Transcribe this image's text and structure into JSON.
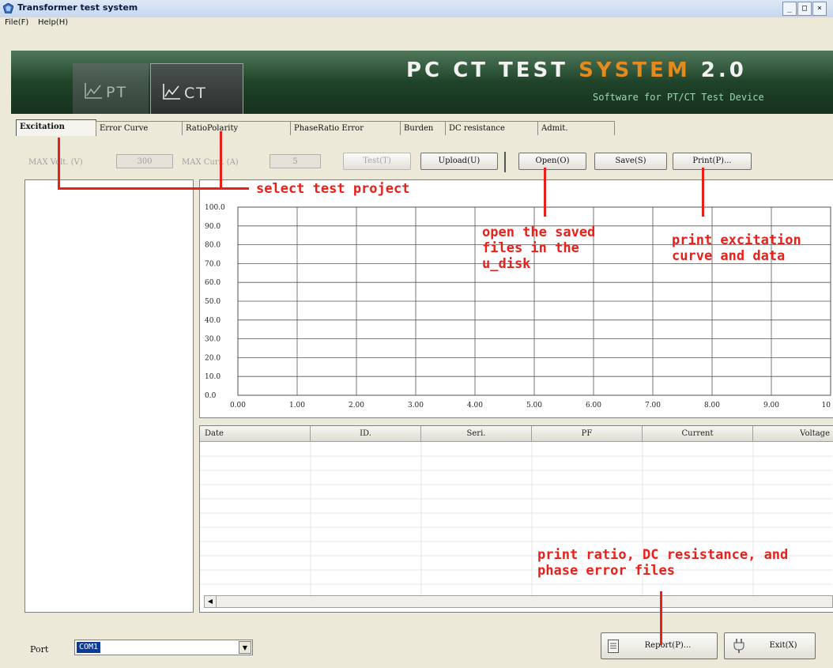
{
  "window": {
    "title": "Transformer test system",
    "controls": [
      "_",
      "□",
      "×"
    ]
  },
  "menu": {
    "items": [
      "File(F)",
      "Help(H)"
    ]
  },
  "banner": {
    "mode_tabs": [
      "PT",
      "CT"
    ],
    "active_mode": "CT",
    "title_prefix": "PC CT TEST ",
    "title_highlight": "SYSTEM",
    "title_suffix": " 2.0",
    "subtitle": "Software for PT/CT Test Device",
    "colors": {
      "background": "#1d3f27",
      "highlight": "#e58a1d",
      "subtitle": "#9fd5b7"
    }
  },
  "tabs": [
    "Excitation",
    "Error Curve",
    "RatioPolarity",
    "PhaseRatio Error",
    "Burden",
    "DC resistance",
    "Admit."
  ],
  "active_tab": "Excitation",
  "params": {
    "max_volt_label": "MAX Volt. (V)",
    "max_volt_value": "300",
    "max_curr_label": "MAX Curr. (A)",
    "max_curr_value": "5"
  },
  "toolbar": {
    "test": "Test(T)",
    "upload": "Upload(U)",
    "open": "Open(O)",
    "save": "Save(S)",
    "print": "Print(P)..."
  },
  "chart_data": {
    "type": "line",
    "x_ticks": [
      "0.00",
      "1.00",
      "2.00",
      "3.00",
      "4.00",
      "5.00",
      "6.00",
      "7.00",
      "8.00",
      "9.00",
      "10"
    ],
    "y_ticks": [
      "0.0",
      "10.0",
      "20.0",
      "30.0",
      "40.0",
      "50.0",
      "60.0",
      "70.0",
      "80.0",
      "90.0",
      "100.0"
    ],
    "xlim": [
      0,
      10
    ],
    "ylim": [
      0,
      100
    ],
    "grid": true,
    "series": []
  },
  "table": {
    "columns": [
      "Date",
      "ID.",
      "Seri.",
      "PF",
      "Current",
      "Voltage"
    ],
    "rows": []
  },
  "bottom": {
    "port_label": "Port",
    "port_value": "COM1",
    "report": "Report(P)...",
    "exit": "Exit(X)"
  },
  "annotations": {
    "select_test": "select test project",
    "open_saved": [
      "open the saved",
      "files in the",
      "u_disk"
    ],
    "print_excitation": [
      "print excitation",
      "curve and data"
    ],
    "print_ratio": [
      "print ratio, DC resistance, and",
      "phase error files"
    ]
  }
}
